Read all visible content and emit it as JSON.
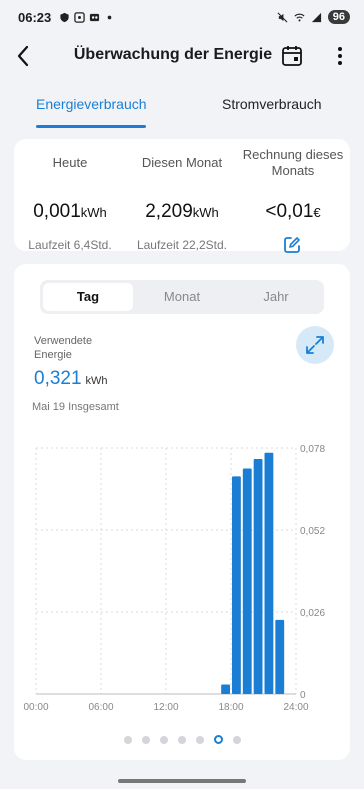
{
  "status_bar": {
    "time": "06:23",
    "battery": "96"
  },
  "header": {
    "title": "Überwachung der Energie",
    "icons": [
      "back-arrow-icon",
      "calendar-icon",
      "more-vert-icon"
    ]
  },
  "tabs": [
    {
      "label": "Energieverbrauch",
      "active": true
    },
    {
      "label": "Stromverbrauch",
      "active": false
    }
  ],
  "summary": [
    {
      "label": "Heute",
      "value": "0,001",
      "unit": "kWh",
      "sub": "Laufzeit 6,4Std."
    },
    {
      "label": "Diesen Monat",
      "value": "2,209",
      "unit": "kWh",
      "sub": "Laufzeit 22,2Std."
    },
    {
      "label": "Rechnung dieses Monats",
      "value": "<0,01",
      "unit": "€",
      "sub_icon": "edit-icon"
    }
  ],
  "segment": {
    "items": [
      "Tag",
      "Monat",
      "Jahr"
    ],
    "selected": "Tag"
  },
  "usage": {
    "label": "Verwendete Energie",
    "value": "0,321",
    "unit": "kWh",
    "date_text": "Mai 19 Insgesamt"
  },
  "accent_color": "#1a7fd4",
  "pager": {
    "count": 7,
    "active": 5
  },
  "chart_data": {
    "type": "bar",
    "x_ticks": [
      "00:00",
      "06:00",
      "12:00",
      "18:00",
      "24:00"
    ],
    "x_range": [
      0,
      24
    ],
    "y_ticks": [
      "0,078",
      "0,052",
      "0,026",
      "0"
    ],
    "y_range": [
      0,
      0.078
    ],
    "bars": [
      {
        "hour": 17,
        "value": 0.003
      },
      {
        "hour": 18,
        "value": 0.069
      },
      {
        "hour": 19,
        "value": 0.0715
      },
      {
        "hour": 20,
        "value": 0.0745
      },
      {
        "hour": 21,
        "value": 0.0765
      },
      {
        "hour": 22,
        "value": 0.0235
      }
    ],
    "grid": true
  }
}
